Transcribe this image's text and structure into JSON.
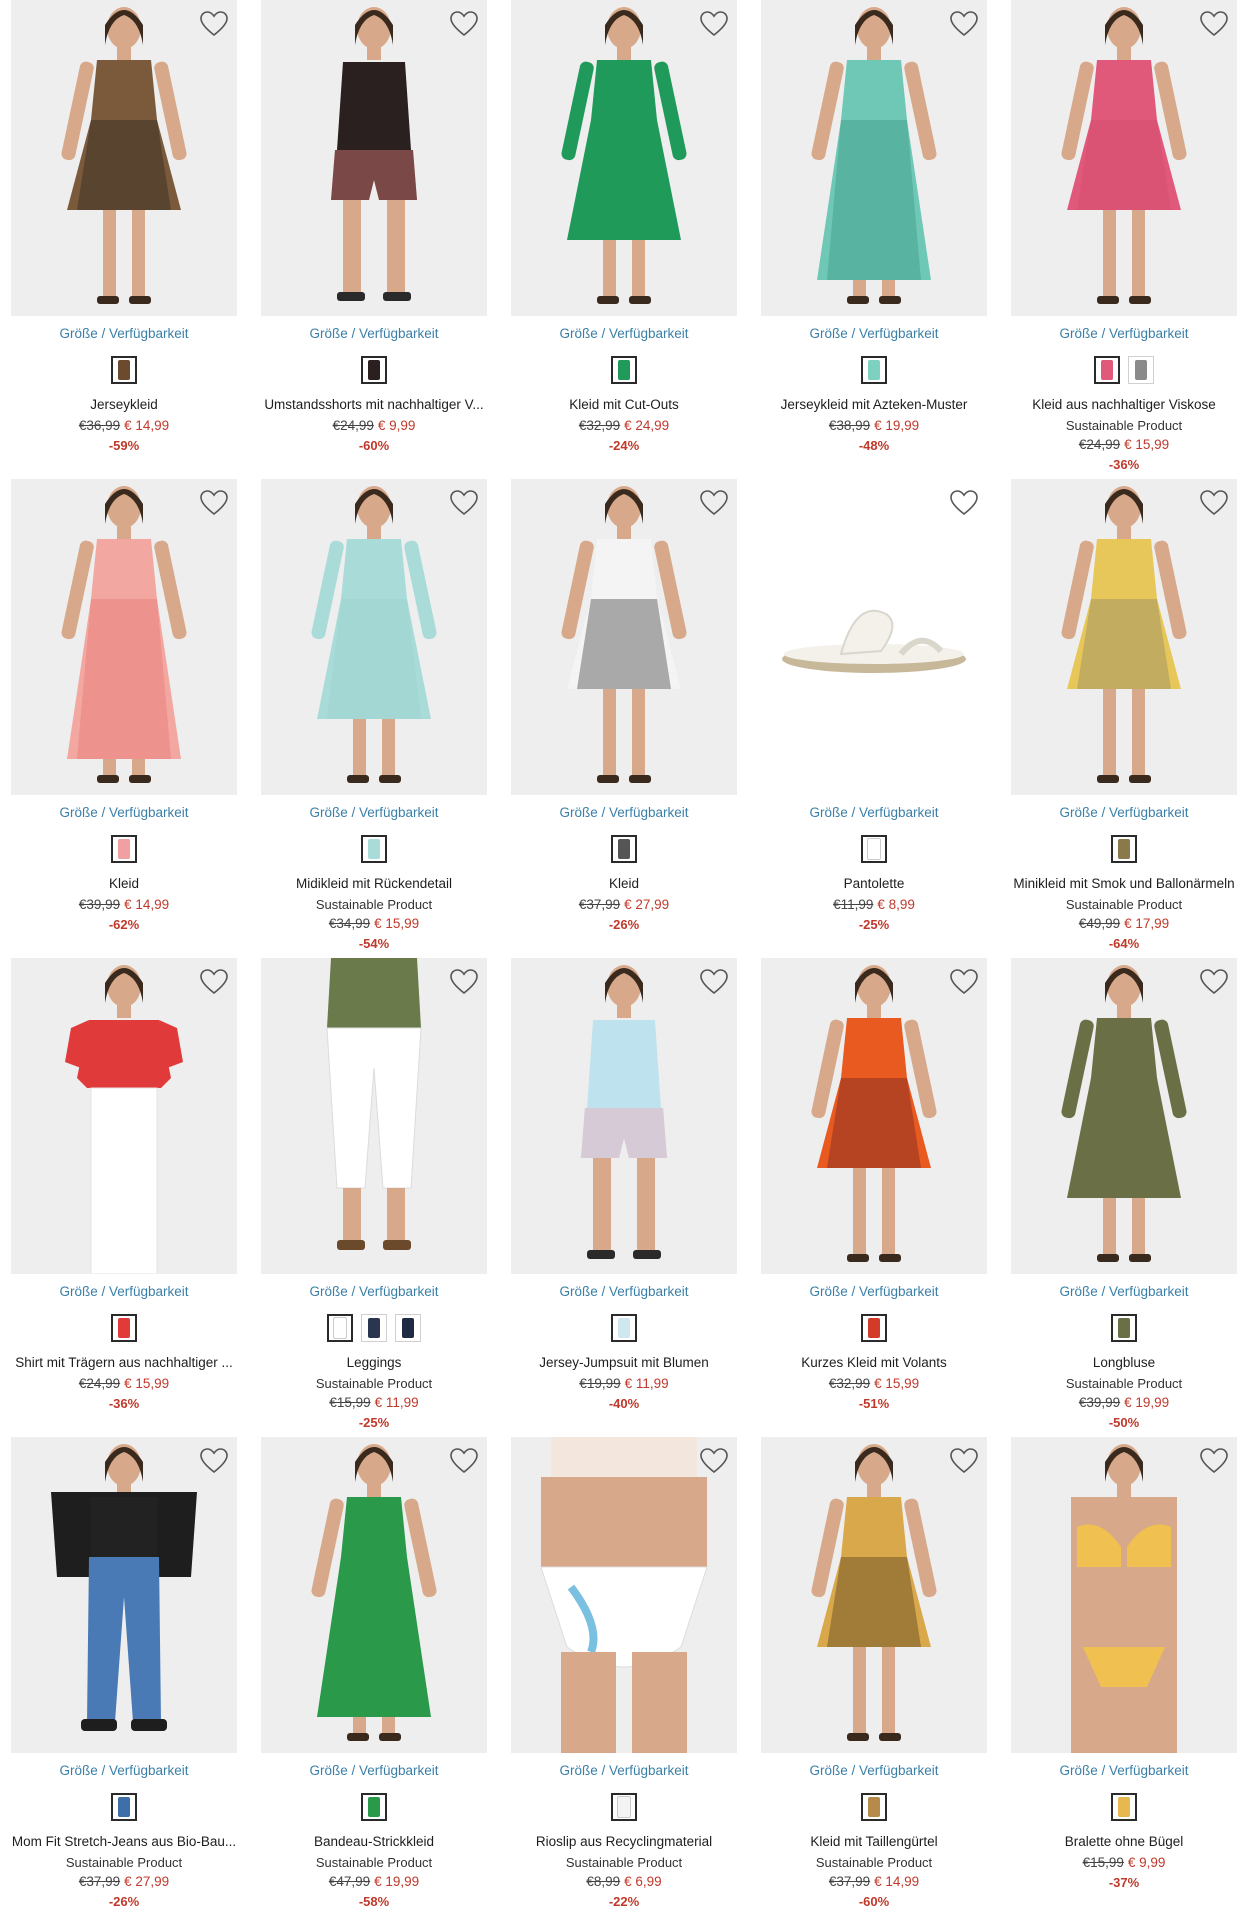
{
  "labels": {
    "availability": "Größe / Verfügbarkeit"
  },
  "colors": {
    "link": "#3a7fa8",
    "sale": "#c0392b",
    "image_bg": "#eeeeef"
  },
  "products": [
    {
      "name": "Jerseykleid",
      "sustainable": "",
      "old_price": "€36,99",
      "new_price": "€ 14,99",
      "discount": "-59%",
      "figure": "dress",
      "colors": [
        "#7a5a3a",
        "#1e1e1e"
      ],
      "swatches": [
        "#6b4a2e"
      ],
      "bg": "#eeeeef"
    },
    {
      "name": "Umstandsshorts mit nachhaltiger V...",
      "sustainable": "",
      "old_price": "€24,99",
      "new_price": "€ 9,99",
      "discount": "-60%",
      "figure": "shorts",
      "colors": [
        "#2a2020",
        "#c45050"
      ],
      "swatches": [
        "#2a2020"
      ],
      "bg": "#eeeeef"
    },
    {
      "name": "Kleid mit Cut-Outs",
      "sustainable": "",
      "old_price": "€32,99",
      "new_price": "€ 24,99",
      "discount": "-24%",
      "figure": "dress-long",
      "colors": [
        "#1f9a5a",
        "#1f9a5a"
      ],
      "swatches": [
        "#1f9a5a"
      ],
      "bg": "#eeeeef"
    },
    {
      "name": "Jerseykleid mit Azteken-Muster",
      "sustainable": "",
      "old_price": "€38,99",
      "new_price": "€ 19,99",
      "discount": "-48%",
      "figure": "maxi",
      "colors": [
        "#6fc8b5",
        "#2f8f7a"
      ],
      "swatches": [
        "#7fd1bf"
      ],
      "bg": "#eeeeef"
    },
    {
      "name": "Kleid aus nachhaltiger Viskose",
      "sustainable": "Sustainable Product",
      "old_price": "€24,99",
      "new_price": "€ 15,99",
      "discount": "-36%",
      "figure": "dress",
      "colors": [
        "#e0587a",
        "#d04a6a"
      ],
      "swatches": [
        "#e0587a",
        "#8a8a8a"
      ],
      "bg": "#eeeeef"
    },
    {
      "name": "Kleid",
      "sustainable": "",
      "old_price": "€39,99",
      "new_price": "€ 14,99",
      "discount": "-62%",
      "figure": "maxi",
      "colors": [
        "#f2a8a0",
        "#e86a6a"
      ],
      "swatches": [
        "#f0a0a0"
      ],
      "bg": "#eeeeef"
    },
    {
      "name": "Midikleid mit Rückendetail",
      "sustainable": "Sustainable Product",
      "old_price": "€34,99",
      "new_price": "€ 15,99",
      "discount": "-54%",
      "figure": "dress-long",
      "colors": [
        "#a9dcd8",
        "#98cfcc"
      ],
      "swatches": [
        "#a9dcd8"
      ],
      "bg": "#eeeeef"
    },
    {
      "name": "Kleid",
      "sustainable": "",
      "old_price": "€37,99",
      "new_price": "€ 27,99",
      "discount": "-26%",
      "figure": "dress",
      "colors": [
        "#f4f4f4",
        "#1e1e1e"
      ],
      "swatches": [
        "#555555"
      ],
      "bg": "#eeeeef"
    },
    {
      "name": "Pantolette",
      "sustainable": "",
      "old_price": "€11,99",
      "new_price": "€ 8,99",
      "discount": "-25%",
      "figure": "sandal",
      "colors": [
        "#f3f1ea",
        "#c8b89a"
      ],
      "swatches": [
        "#ffffff"
      ],
      "bg": "#ffffff"
    },
    {
      "name": "Minikleid mit Smok und Ballonärmeln",
      "sustainable": "Sustainable Product",
      "old_price": "€49,99",
      "new_price": "€ 17,99",
      "discount": "-64%",
      "figure": "dress",
      "colors": [
        "#e8c75a",
        "#7a7a6a"
      ],
      "swatches": [
        "#8a7a4a"
      ],
      "bg": "#eeeeef"
    },
    {
      "name": "Shirt mit Trägern aus nachhaltiger ...",
      "sustainable": "",
      "old_price": "€24,99",
      "new_price": "€ 15,99",
      "discount": "-36%",
      "figure": "top",
      "colors": [
        "#e03a3a",
        "#ffffff"
      ],
      "swatches": [
        "#e03a3a"
      ],
      "bg": "#eeeeef"
    },
    {
      "name": "Leggings",
      "sustainable": "Sustainable Product",
      "old_price": "€15,99",
      "new_price": "€ 11,99",
      "discount": "-25%",
      "figure": "legs",
      "colors": [
        "#ffffff",
        "#6a7a4a"
      ],
      "swatches": [
        "#ffffff",
        "#2a3550",
        "#1e2a44"
      ],
      "bg": "#eeeeef"
    },
    {
      "name": "Jersey-Jumpsuit mit Blumen",
      "sustainable": "",
      "old_price": "€19,99",
      "new_price": "€ 11,99",
      "discount": "-40%",
      "figure": "shorts",
      "colors": [
        "#bfe3ee",
        "#e8a0b0"
      ],
      "swatches": [
        "#cfe8ef"
      ],
      "bg": "#eeeeef"
    },
    {
      "name": "Kurzes Kleid mit Volants",
      "sustainable": "",
      "old_price": "€32,99",
      "new_price": "€ 15,99",
      "discount": "-51%",
      "figure": "dress",
      "colors": [
        "#e85a20",
        "#5a1e2a"
      ],
      "swatches": [
        "#d23a2a"
      ],
      "bg": "#eeeeef"
    },
    {
      "name": "Longbluse",
      "sustainable": "Sustainable Product",
      "old_price": "€39,99",
      "new_price": "€ 19,99",
      "discount": "-50%",
      "figure": "dress-long",
      "colors": [
        "#6b6f45",
        "#6b6f45"
      ],
      "swatches": [
        "#6b6f45"
      ],
      "bg": "#eeeeef"
    },
    {
      "name": "Mom Fit Stretch-Jeans aus Bio-Bau...",
      "sustainable": "Sustainable Product",
      "old_price": "€37,99",
      "new_price": "€ 27,99",
      "discount": "-26%",
      "figure": "jeans",
      "colors": [
        "#4a7ab5",
        "#1e1e1e"
      ],
      "swatches": [
        "#3f6fa8"
      ],
      "bg": "#eeeeef"
    },
    {
      "name": "Bandeau-Strickkleid",
      "sustainable": "Sustainable Product",
      "old_price": "€47,99",
      "new_price": "€ 19,99",
      "discount": "-58%",
      "figure": "maxi",
      "colors": [
        "#2a9a4a",
        "#2a9a4a"
      ],
      "swatches": [
        "#2a9a4a"
      ],
      "bg": "#eeeeef"
    },
    {
      "name": "Rioslip aus Recyclingmaterial",
      "sustainable": "Sustainable Product",
      "old_price": "€8,99",
      "new_price": "€ 6,99",
      "discount": "-22%",
      "figure": "brief",
      "colors": [
        "#ffffff",
        "#7ac0e0"
      ],
      "swatches": [
        "#f4f4f4"
      ],
      "bg": "#eeeeef"
    },
    {
      "name": "Kleid mit Taillengürtel",
      "sustainable": "Sustainable Product",
      "old_price": "€37,99",
      "new_price": "€ 14,99",
      "discount": "-60%",
      "figure": "dress",
      "colors": [
        "#d9a84a",
        "#3a2a1a"
      ],
      "swatches": [
        "#b58a4a"
      ],
      "bg": "#eeeeef"
    },
    {
      "name": "Bralette ohne Bügel",
      "sustainable": "",
      "old_price": "€15,99",
      "new_price": "€ 9,99",
      "discount": "-37%",
      "figure": "bra",
      "colors": [
        "#f0c050",
        "#f0c050"
      ],
      "swatches": [
        "#e8b850"
      ],
      "bg": "#eeeeef"
    }
  ]
}
